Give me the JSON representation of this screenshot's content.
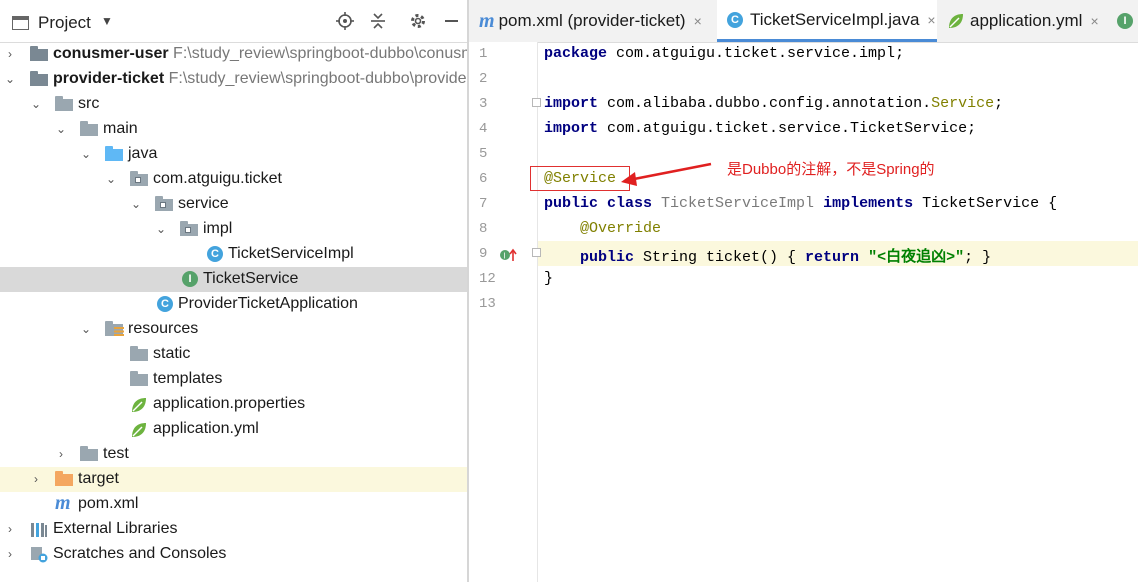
{
  "project_panel": {
    "title": "Project",
    "tree": [
      {
        "label": "conusmer-user",
        "path": "F:\\study_review\\springboot-dubbo\\conusmer-user"
      },
      {
        "label": "provider-ticket",
        "path": "F:\\study_review\\springboot-dubbo\\provider-ticket"
      },
      {
        "label": "src"
      },
      {
        "label": "main"
      },
      {
        "label": "java"
      },
      {
        "label": "com.atguigu.ticket"
      },
      {
        "label": "service"
      },
      {
        "label": "impl"
      },
      {
        "label": "TicketServiceImpl"
      },
      {
        "label": "TicketService"
      },
      {
        "label": "ProviderTicketApplication"
      },
      {
        "label": "resources"
      },
      {
        "label": "static"
      },
      {
        "label": "templates"
      },
      {
        "label": "application.properties"
      },
      {
        "label": "application.yml"
      },
      {
        "label": "test"
      },
      {
        "label": "target"
      },
      {
        "label": "pom.xml"
      },
      {
        "label": "External Libraries"
      },
      {
        "label": "Scratches and Consoles"
      }
    ]
  },
  "tabs": [
    {
      "label": "pom.xml (provider-ticket)",
      "close": "×"
    },
    {
      "label": "TicketServiceImpl.java",
      "close": "×"
    },
    {
      "label": "application.yml",
      "close": "×"
    }
  ],
  "editor": {
    "line_numbers": [
      "1",
      "2",
      "3",
      "4",
      "5",
      "6",
      "7",
      "8",
      "9",
      "12",
      "13"
    ],
    "line1": {
      "kw": "package",
      "rest": " com.atguigu.ticket.service.impl;"
    },
    "line3": {
      "kw": "import",
      "mid": " com.alibaba.dubbo.config.annotation.",
      "ann": "Service",
      "end": ";"
    },
    "line4": {
      "kw": "import",
      "rest": " com.atguigu.ticket.service.TicketService;"
    },
    "line6": {
      "ann": "@Service"
    },
    "line7": {
      "kw1": "public class",
      "cls": " TicketServiceImpl ",
      "kw2": "implements",
      "rest": " TicketService {"
    },
    "line8": {
      "ann": "@Override"
    },
    "line9": {
      "kw1": "public",
      "mid": " String ticket() { ",
      "kw2": "return",
      "str": " \"<白夜追凶>\"",
      "end": "; }"
    },
    "line12": {
      "text": "}"
    },
    "annotation_note": "是Dubbo的注解，不是Spring的"
  },
  "colors": {
    "accent": "#4a8bd6",
    "annotation_red": "#e02020",
    "selection": "#d9d9d9",
    "current_line": "#fbf8dd"
  }
}
